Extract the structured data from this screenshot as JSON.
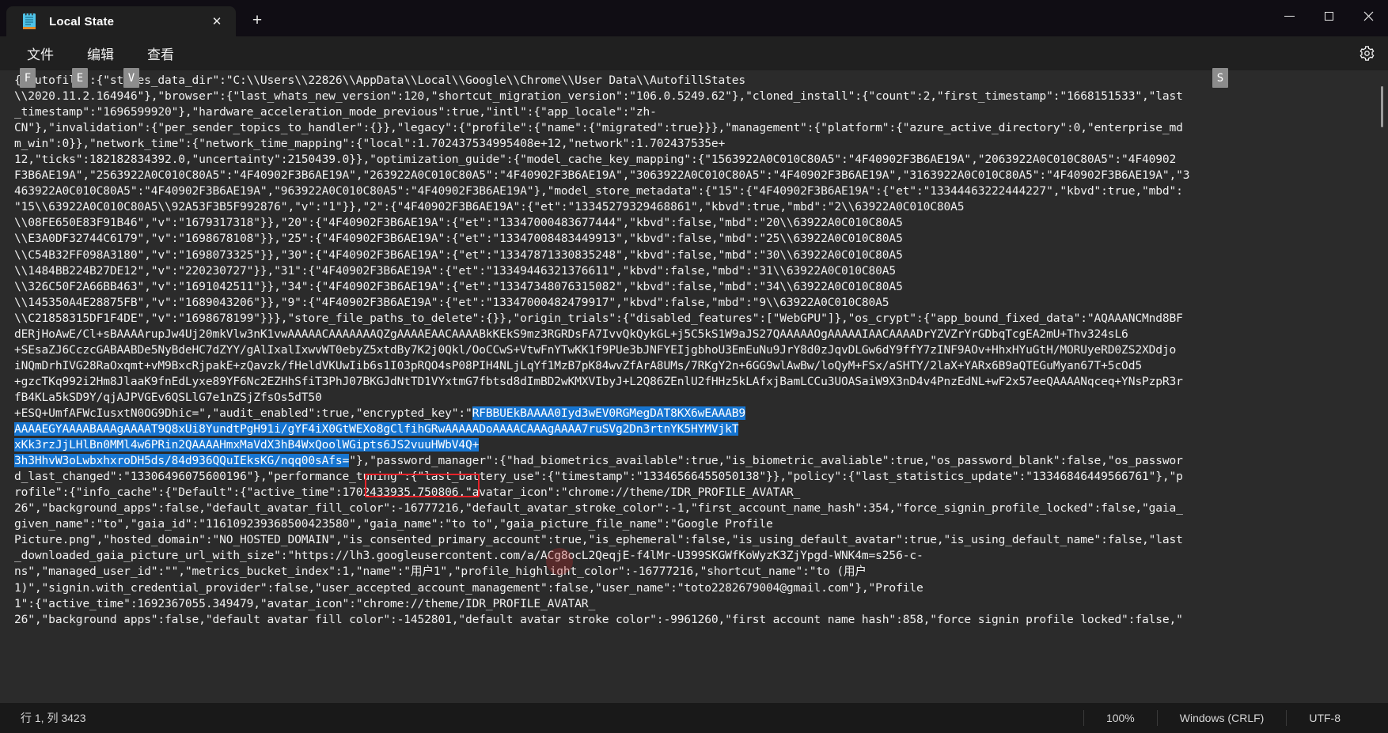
{
  "window": {
    "title": "Local State",
    "app_icon": "notepad-icon",
    "controls": {
      "minimize": "minimize-icon",
      "maximize": "maximize-icon",
      "close": "close-icon"
    }
  },
  "tabbar": {
    "tabs": [
      {
        "label": "Local State",
        "close_label": "✕"
      }
    ],
    "new_tab_label": "+"
  },
  "menubar": {
    "items": [
      {
        "label": "文件",
        "name": "menu-file"
      },
      {
        "label": "编辑",
        "name": "menu-edit"
      },
      {
        "label": "查看",
        "name": "menu-view"
      }
    ],
    "settings_icon": "gear-icon"
  },
  "hotkey_badges": [
    {
      "letter": "F",
      "target": "menu-file"
    },
    {
      "letter": "E",
      "target": "menu-edit"
    },
    {
      "letter": "V",
      "target": "menu-view"
    },
    {
      "letter": "S",
      "target": "settings-button"
    }
  ],
  "statusbar": {
    "position": "行 1, 列 3423",
    "zoom": "100%",
    "line_ending": "Windows (CRLF)",
    "encoding": "UTF-8"
  },
  "annotations": {
    "highlight_box_label": "encrypted_key",
    "highlight_color": "#e8232a",
    "selection_color": "#1675d1"
  },
  "editor": {
    "lines": [
      {
        "pre": "{ autofill\":{\"states_data_dir\":\"C:\\\\Users\\\\22826\\\\AppData\\\\Local\\\\Google\\\\Chrome\\\\User Data\\\\AutofillStates",
        "sel": "",
        "post": ""
      },
      {
        "pre": "\\\\2020.11.2.164946\"},\"browser\":{\"last_whats_new_version\":120,\"shortcut_migration_version\":\"106.0.5249.62\"},\"cloned_install\":{\"count\":2,\"first_timestamp\":\"1668151533\",\"last",
        "sel": "",
        "post": ""
      },
      {
        "pre": "_timestamp\":\"1696599920\"},\"hardware_acceleration_mode_previous\":true,\"intl\":{\"app_locale\":\"zh-",
        "sel": "",
        "post": ""
      },
      {
        "pre": "CN\"},\"invalidation\":{\"per_sender_topics_to_handler\":{}},\"legacy\":{\"profile\":{\"name\":{\"migrated\":true}}},\"management\":{\"platform\":{\"azure_active_directory\":0,\"enterprise_md",
        "sel": "",
        "post": ""
      },
      {
        "pre": "m_win\":0}},\"network_time\":{\"network_time_mapping\":{\"local\":1.702437534995408e+12,\"network\":1.702437535e+",
        "sel": "",
        "post": ""
      },
      {
        "pre": "12,\"ticks\":182182834392.0,\"uncertainty\":2150439.0}},\"optimization_guide\":{\"model_cache_key_mapping\":{\"1563922A0C010C80A5\":\"4F40902F3B6AE19A\",\"2063922A0C010C80A5\":\"4F40902",
        "sel": "",
        "post": ""
      },
      {
        "pre": "F3B6AE19A\",\"2563922A0C010C80A5\":\"4F40902F3B6AE19A\",\"263922A0C010C80A5\":\"4F40902F3B6AE19A\",\"3063922A0C010C80A5\":\"4F40902F3B6AE19A\",\"3163922A0C010C80A5\":\"4F40902F3B6AE19A\",\"3",
        "sel": "",
        "post": ""
      },
      {
        "pre": "463922A0C010C80A5\":\"4F40902F3B6AE19A\",\"963922A0C010C80A5\":\"4F40902F3B6AE19A\"},\"model_store_metadata\":{\"15\":{\"4F40902F3B6AE19A\":{\"et\":\"13344463222444227\",\"kbvd\":true,\"mbd\":",
        "sel": "",
        "post": ""
      },
      {
        "pre": "\"15\\\\63922A0C010C80A5\\\\92A53F3B5F992876\",\"v\":\"1\"}},\"2\":{\"4F40902F3B6AE19A\":{\"et\":\"13345279329468861\",\"kbvd\":true,\"mbd\":\"2\\\\63922A0C010C80A5",
        "sel": "",
        "post": ""
      },
      {
        "pre": "\\\\08FE650E83F91B46\",\"v\":\"1679317318\"}},\"20\":{\"4F40902F3B6AE19A\":{\"et\":\"13347000483677444\",\"kbvd\":false,\"mbd\":\"20\\\\63922A0C010C80A5",
        "sel": "",
        "post": ""
      },
      {
        "pre": "\\\\E3A0DF32744C6179\",\"v\":\"1698678108\"}},\"25\":{\"4F40902F3B6AE19A\":{\"et\":\"13347008483449913\",\"kbvd\":false,\"mbd\":\"25\\\\63922A0C010C80A5",
        "sel": "",
        "post": ""
      },
      {
        "pre": "\\\\C54B32FF098A3180\",\"v\":\"1698073325\"}},\"30\":{\"4F40902F3B6AE19A\":{\"et\":\"13347871330835248\",\"kbvd\":false,\"mbd\":\"30\\\\63922A0C010C80A5",
        "sel": "",
        "post": ""
      },
      {
        "pre": "\\\\1484BB224B27DE12\",\"v\":\"220230727\"}},\"31\":{\"4F40902F3B6AE19A\":{\"et\":\"13349446321376611\",\"kbvd\":false,\"mbd\":\"31\\\\63922A0C010C80A5",
        "sel": "",
        "post": ""
      },
      {
        "pre": "\\\\326C50F2A66BB463\",\"v\":\"1691042511\"}},\"34\":{\"4F40902F3B6AE19A\":{\"et\":\"13347348076315082\",\"kbvd\":false,\"mbd\":\"34\\\\63922A0C010C80A5",
        "sel": "",
        "post": ""
      },
      {
        "pre": "\\\\145350A4E28875FB\",\"v\":\"1689043206\"}},\"9\":{\"4F40902F3B6AE19A\":{\"et\":\"13347000482479917\",\"kbvd\":false,\"mbd\":\"9\\\\63922A0C010C80A5",
        "sel": "",
        "post": ""
      },
      {
        "pre": "\\\\C21858315DF1F4DE\",\"v\":\"1698678199\"}}},\"store_file_paths_to_delete\":{}},\"origin_trials\":{\"disabled_features\":[\"WebGPU\"]},\"os_crypt\":{\"app_bound_fixed_data\":\"AQAAANCMnd8BF",
        "sel": "",
        "post": ""
      },
      {
        "pre": "dERjHoAwE/Cl+sBAAAArupJw4Uj20mkVlw3nK1vwAAAAACAAAAAAAQZgAAAAEAACAAAABkKEkS9mz3RGRDsFA7IvvQkQykGL+j5C5kS1W9aJS27QAAAAAOgAAAAAIAACAAAADrYZVZrYrGDbqTcgEA2mU+Thv324sL6",
        "sel": "",
        "post": ""
      },
      {
        "pre": "+SEsaZJ6CczcGABAABDe5NyBdeHC7dZYY/gAlIxalIxwvWT0ebyZ5xtdBy7K2j0Qkl/OoCCwS+VtwFnYTwKK1f9PUe3bJNFYEIjgbhoU3EmEuNu9JrY8d0zJqvDLGw6dY9ffY7zINF9AOv+HhxHYuGtH/MORUyeRD0ZS2XDdjo",
        "sel": "",
        "post": ""
      },
      {
        "pre": "iNQmDrhIVG28RaOxqmt+vM9BxcRjpakE+zQavzk/fHeldVKUwIib6s1I03pRQO4sP08PIH4NLjLqYf1MzB7pK84wvZfArA8UMs/7RKgY2n+6GG9wlAwBw/loQyM+FSx/aSHTY/2laX+YARx6B9aQTEGuMyan67T+5cOd5",
        "sel": "",
        "post": ""
      },
      {
        "pre": "+gzcTKq992i2Hm8JlaaK9fnEdLyxe89YF6Nc2EZHhSfiT3PhJ07BKGJdNtTD1VYxtmG7fbtsd8dImBD2wKMXVIbyJ+L2Q86ZEnlU2fHHz5kLAfxjBamLCCu3UOASaiW9X3nD4v4PnzEdNL+wF2x57eeQAAAANqceq+YNsPzpR3r",
        "sel": "",
        "post": ""
      },
      {
        "pre": "fB4KLa5kSD9Y/qjAJPVGEv6QSLlG7e1nZSjZfsOs5dT50",
        "sel": "",
        "post": ""
      },
      {
        "pre": "+ESQ+UmfAFWcIusxtN0OG9Dhic=\",\"audit_enabled\":true,\"encrypted_key\":\"",
        "sel": "RFBBUEkBAAAA0Iyd3wEV0RGMegDAT8KX6wEAAAB9",
        "post": ""
      },
      {
        "pre": "",
        "sel": "AAAAEGYAAAABAAAgAAAAT9Q8xUi8YundtPgH91i/gYF4iX0GtWEXo8gClfihGRwAAAAADoAAAACAAAgAAAA7ruSVg2Dn3rtnYK5HYMVjkT",
        "post": ""
      },
      {
        "pre": "",
        "sel": "xKk3rzJjLHlBn0MMl4w6PRin2QAAAAHmxMaVdX3hB4WxQoolWGipts6JS2vuuHWbV4Q+",
        "post": ""
      },
      {
        "pre": "",
        "sel": "3h3HhvW3oLwbxhxroDH5ds/84d936QQuIEksKG/nqq00sAfs=",
        "post": "\"},\"password_manager\":{\"had_biometrics_available\":true,\"is_biometric_avaliable\":true,\"os_password_blank\":false,\"os_passwor"
      },
      {
        "pre": "d_last_changed\":\"13306496075600196\"},\"performance_tuning\":{\"last_battery_use\":{\"timestamp\":\"13346566455050138\"}},\"policy\":{\"last_statistics_update\":\"13346846449566761\"},\"p",
        "sel": "",
        "post": ""
      },
      {
        "pre": "rofile\":{\"info_cache\":{\"Default\":{\"active_time\":1702433935.750806,\"avatar_icon\":\"chrome://theme/IDR_PROFILE_AVATAR_",
        "sel": "",
        "post": ""
      },
      {
        "pre": "26\",\"background_apps\":false,\"default_avatar_fill_color\":-16777216,\"default_avatar_stroke_color\":-1,\"first_account_name_hash\":354,\"force_signin_profile_locked\":false,\"gaia_",
        "sel": "",
        "post": ""
      },
      {
        "pre": "given_name\":\"to\",\"gaia_id\":\"116109239368500423580\",\"gaia_name\":\"to to\",\"gaia_picture_file_name\":\"Google Profile",
        "sel": "",
        "post": ""
      },
      {
        "pre": "Picture.png\",\"hosted_domain\":\"NO_HOSTED_DOMAIN\",\"is_consented_primary_account\":true,\"is_ephemeral\":false,\"is_using_default_avatar\":true,\"is_using_default_name\":false,\"last",
        "sel": "",
        "post": ""
      },
      {
        "pre": "_downloaded_gaia_picture_url_with_size\":\"https://lh3.googleusercontent.com/a/ACg8ocL2QeqjE-f4lMr-U399SKGWfKoWyzK3ZjYpgd-WNK4m=s256-c-",
        "sel": "",
        "post": ""
      },
      {
        "pre": "ns\",\"managed_user_id\":\"\",\"metrics_bucket_index\":1,\"name\":\"用户1\",\"profile_highlight_color\":-16777216,\"shortcut_name\":\"to (用户",
        "sel": "",
        "post": ""
      },
      {
        "pre": "1)\",\"signin.with_credential_provider\":false,\"user_accepted_account_management\":false,\"user_name\":\"toto2282679004@gmail.com\"},\"Profile",
        "sel": "",
        "post": ""
      },
      {
        "pre": "1\":{\"active_time\":1692367055.349479,\"avatar_icon\":\"chrome://theme/IDR_PROFILE_AVATAR_",
        "sel": "",
        "post": ""
      },
      {
        "pre": "26\",\"background apps\":false,\"default avatar fill color\":-1452801,\"default avatar stroke color\":-9961260,\"first account name hash\":858,\"force signin profile locked\":false,\"",
        "sel": "",
        "post": ""
      }
    ]
  }
}
